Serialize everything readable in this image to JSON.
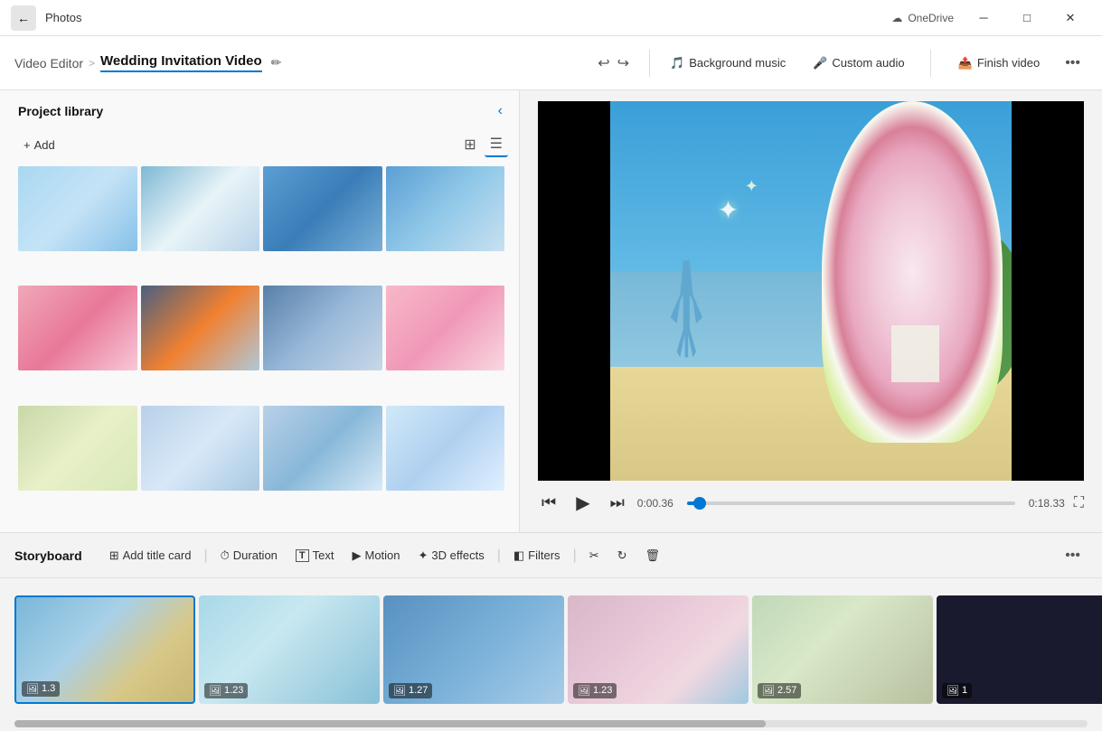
{
  "app": {
    "name": "Photos",
    "onedrive_label": "OneDrive"
  },
  "titlebar": {
    "back_label": "←",
    "app_label": "Photos",
    "onedrive_label": "OneDrive",
    "minimize_label": "─",
    "maximize_label": "□",
    "close_label": "✕"
  },
  "toolbar": {
    "breadcrumb_link": "Video Editor",
    "separator": ">",
    "project_title": "Wedding Invitation Video",
    "undo_label": "↩",
    "redo_label": "↪",
    "background_music_label": "Background music",
    "custom_audio_label": "Custom audio",
    "finish_video_label": "Finish video",
    "more_label": "•••"
  },
  "library": {
    "title": "Project library",
    "add_label": "Add",
    "view_grid_label": "⊞",
    "view_list_label": "☰",
    "collapse_label": "‹",
    "thumbnails": [
      {
        "id": 1,
        "color_class": "t1"
      },
      {
        "id": 2,
        "color_class": "t2"
      },
      {
        "id": 3,
        "color_class": "t3"
      },
      {
        "id": 4,
        "color_class": "t4"
      },
      {
        "id": 5,
        "color_class": "t5"
      },
      {
        "id": 6,
        "color_class": "t6"
      },
      {
        "id": 7,
        "color_class": "t7"
      },
      {
        "id": 8,
        "color_class": "t8"
      },
      {
        "id": 9,
        "color_class": "t9"
      },
      {
        "id": 10,
        "color_class": "t10"
      },
      {
        "id": 11,
        "color_class": "t11"
      },
      {
        "id": 12,
        "color_class": "t12"
      }
    ]
  },
  "video_player": {
    "current_time": "0:00.36",
    "total_time": "0:18.33",
    "progress_percent": 4
  },
  "storyboard": {
    "title": "Storyboard",
    "add_title_card_label": "Add title card",
    "duration_label": "Duration",
    "text_label": "Text",
    "motion_label": "Motion",
    "effects_3d_label": "3D effects",
    "filters_label": "Filters",
    "more_label": "•••",
    "items": [
      {
        "duration": "1.3",
        "color": "linear-gradient(135deg, #7ab8d8 0%, #a8d0e8 40%, #d8c888 70%, #c8b878 100%)"
      },
      {
        "duration": "1.23",
        "color": "linear-gradient(135deg, #a8d8e8 0%, #c8e8f0 40%, #88c0d8 100%)"
      },
      {
        "duration": "1.27",
        "color": "linear-gradient(135deg, #5890c0 0%, #78b0d8 50%, #a8cce8 100%)"
      },
      {
        "duration": "1.23",
        "color": "linear-gradient(135deg, #d8b8c8 0%, #e8c8d8 40%, #f0d8e0 70%, #a0c8e0 100%)"
      },
      {
        "duration": "2.57",
        "color": "linear-gradient(135deg, #c0d8b8 0%, #d8e8c8 40%, #b8c0a0 100%)"
      },
      {
        "duration": "1",
        "color": "#1a1a2e"
      }
    ]
  }
}
